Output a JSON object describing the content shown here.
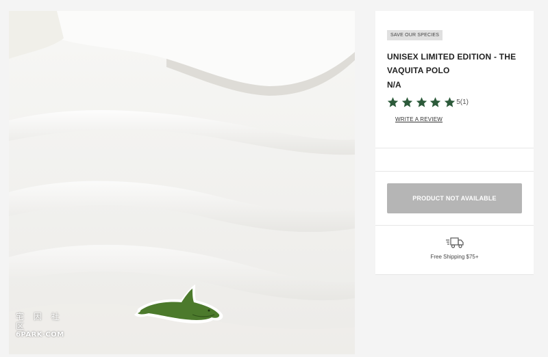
{
  "watermark": {
    "line1": "宅 因 社 区",
    "line2": "6PARK·COM"
  },
  "product": {
    "tag": "SAVE OUR SPECIES",
    "title_line1": "UNISEX LIMITED EDITION - THE",
    "title_line2": "VAQUITA POLO",
    "price": "N/A",
    "rating": {
      "stars": 5,
      "value": 5,
      "count_text": "5(1)"
    },
    "review_link": "WRITE A REVIEW"
  },
  "cta": {
    "label": "PRODUCT NOT AVAILABLE"
  },
  "shipping": {
    "icon": "truck-icon",
    "text": "Free Shipping $75+"
  },
  "colors": {
    "star": "#2c5a3a",
    "button_disabled": "#b5b5b5",
    "logo_green": "#4c7a2c"
  }
}
